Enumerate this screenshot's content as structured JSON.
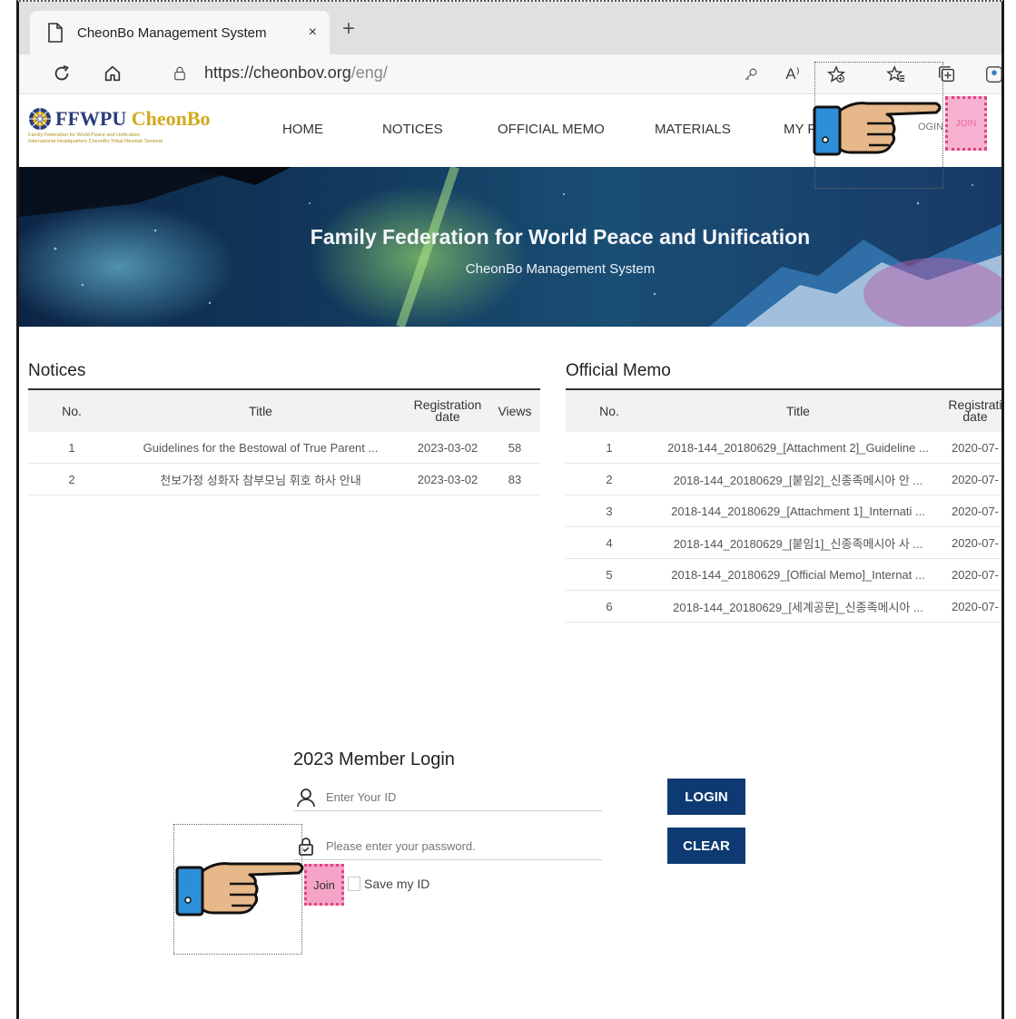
{
  "browser": {
    "tab_title": "CheonBo Management System",
    "tab_close": "×",
    "new_tab": "+",
    "url_host": "https://cheonbov.org",
    "url_path": "/eng/",
    "read_aloud": "A⁾"
  },
  "site": {
    "logo_main_a": "FFWPU ",
    "logo_main_b": "CheonBo",
    "logo_sub_1": "Family Federation for World Peace and Unification",
    "logo_sub_2": "International Headquarters CheonBo Tribal Messiah Seminar",
    "nav": [
      "HOME",
      "NOTICES",
      "OFFICIAL MEMO",
      "MATERIALS",
      "MY P"
    ],
    "header_login": "OGIN",
    "header_join": "JOIN"
  },
  "banner": {
    "title": "Family Federation for World Peace and Unification",
    "subtitle": "CheonBo Management System"
  },
  "notices": {
    "heading": "Notices",
    "headers": {
      "no": "No.",
      "title": "Title",
      "reg_top": "Registration",
      "reg_bottom": "date",
      "views": "Views"
    },
    "rows": [
      {
        "no": "1",
        "title": "Guidelines for the Bestowal of True Parent ...",
        "date": "2023-03-02",
        "views": "58"
      },
      {
        "no": "2",
        "title": "천보가정 성화자 참부모님 휘호 하사 안내",
        "date": "2023-03-02",
        "views": "83"
      }
    ]
  },
  "memo": {
    "heading": "Official Memo",
    "headers": {
      "no": "No.",
      "title": "Title",
      "reg_top": "Registrati",
      "reg_bottom": "date"
    },
    "rows": [
      {
        "no": "1",
        "title": "2018-144_20180629_[Attachment 2]_Guideline ...",
        "date": "2020-07-"
      },
      {
        "no": "2",
        "title": "2018-144_20180629_[붙임2]_신종족메시아 안 ...",
        "date": "2020-07-"
      },
      {
        "no": "3",
        "title": "2018-144_20180629_[Attachment 1]_Internati ...",
        "date": "2020-07-"
      },
      {
        "no": "4",
        "title": "2018-144_20180629_[붙임1]_신종족메시아 사 ...",
        "date": "2020-07-"
      },
      {
        "no": "5",
        "title": "2018-144_20180629_[Official Memo]_Internat ...",
        "date": "2020-07-"
      },
      {
        "no": "6",
        "title": "2018-144_20180629_[세계공문]_신종족메시아 ...",
        "date": "2020-07-"
      }
    ]
  },
  "login": {
    "title": "2023 Member Login",
    "id_placeholder": "Enter Your ID",
    "pw_placeholder": "Please enter your password.",
    "login_button": "LOGIN",
    "clear_button": "CLEAR",
    "join_link": "Join",
    "save_id": "Save my ID"
  },
  "colors": {
    "brand_navy": "#0e3a73",
    "logo_blue": "#2a3d7a",
    "logo_gold": "#d3a81e",
    "highlight_pink": "#f5a3c6"
  }
}
